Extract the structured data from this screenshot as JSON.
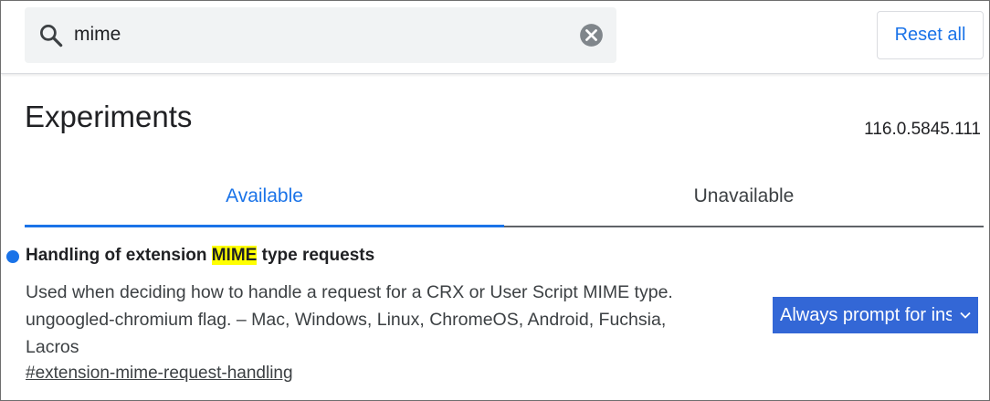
{
  "search": {
    "value": "mime",
    "icon": "search-icon",
    "clear_icon": "clear-icon"
  },
  "header": {
    "reset_label": "Reset all"
  },
  "page": {
    "title": "Experiments",
    "version": "116.0.5845.111"
  },
  "tabs": [
    {
      "label": "Available",
      "active": true
    },
    {
      "label": "Unavailable",
      "active": false
    }
  ],
  "experiment": {
    "title_before": "Handling of extension ",
    "title_highlight": "MIME",
    "title_after": " type requests",
    "description_line1": "Used when deciding how to handle a request for a CRX or User Script MIME type.",
    "description_line2": "ungoogled-chromium flag. – Mac, Windows, Linux, ChromeOS, Android, Fuchsia,",
    "description_line3": "Lacros",
    "link": "#extension-mime-request-handling",
    "selected_option": "Always prompt for install"
  },
  "colors": {
    "accent": "#1a73e8",
    "select_bg": "#3367d6",
    "highlight": "#ffff00"
  }
}
